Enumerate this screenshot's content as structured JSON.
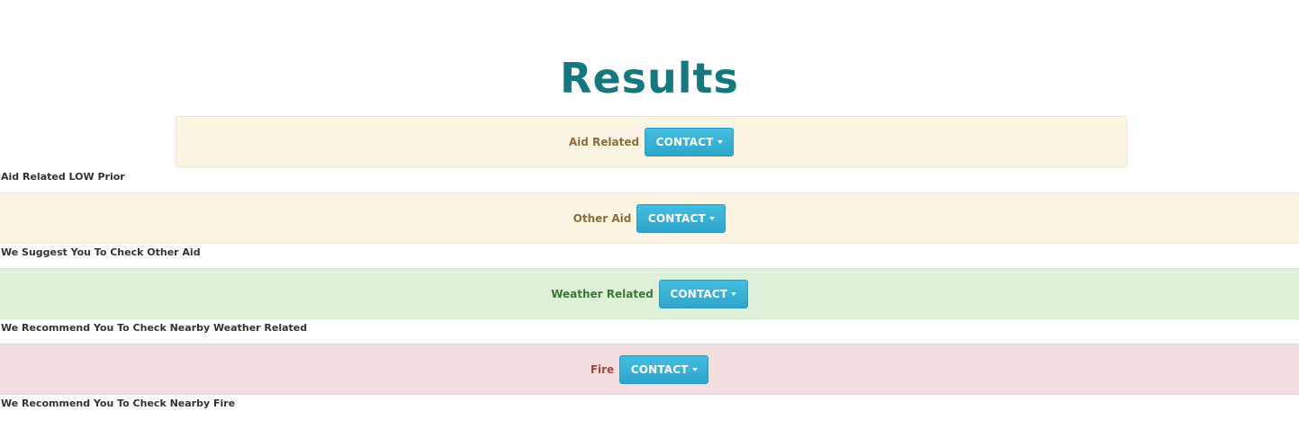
{
  "page": {
    "title": "Results"
  },
  "results": [
    {
      "category": "Aid Related",
      "button_label": "CONTACT",
      "message": "Aid Related LOW Prior"
    },
    {
      "category": "Other Aid",
      "button_label": "CONTACT",
      "message": "We Suggest You To Check Other Aid"
    },
    {
      "category": "Weather Related",
      "button_label": "CONTACT",
      "message": "We Recommend You To Check Nearby Weather Related"
    },
    {
      "category": "Fire",
      "button_label": "CONTACT",
      "message": "We Recommend You To Check Nearby Fire"
    }
  ],
  "colors": {
    "title": "#17777f",
    "warning_bg": "#fcf5e3",
    "warning_text": "#8a6d3b",
    "success_bg": "#dff0d8",
    "success_text": "#3c763d",
    "danger_bg": "#f2dede",
    "danger_text": "#a94442",
    "button_bg": "#31b0d5"
  },
  "icons": {
    "dropdown": "caret-down-icon"
  }
}
